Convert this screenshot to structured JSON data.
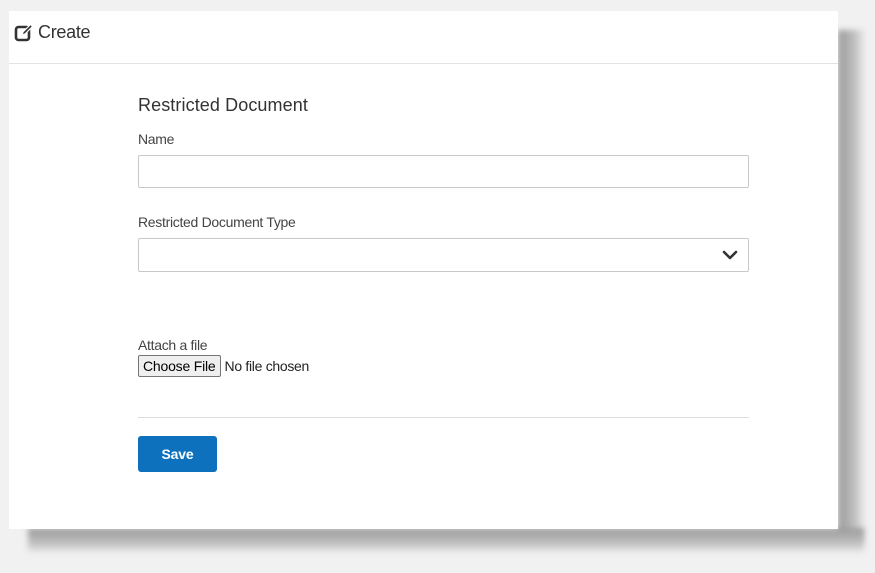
{
  "header": {
    "icon": "edit-square-icon",
    "title": "Create"
  },
  "form": {
    "section_title": "Restricted Document",
    "name_label": "Name",
    "name_value": "",
    "type_label": "Restricted Document Type",
    "type_selected": "",
    "type_icon": "chevron-down-icon",
    "attach_label": "Attach a file",
    "choose_file_label": "Choose File",
    "file_status": "No file chosen",
    "save_label": "Save"
  },
  "colors": {
    "primary": "#0d71bd",
    "text": "#333333",
    "border": "#c8c8c8"
  }
}
